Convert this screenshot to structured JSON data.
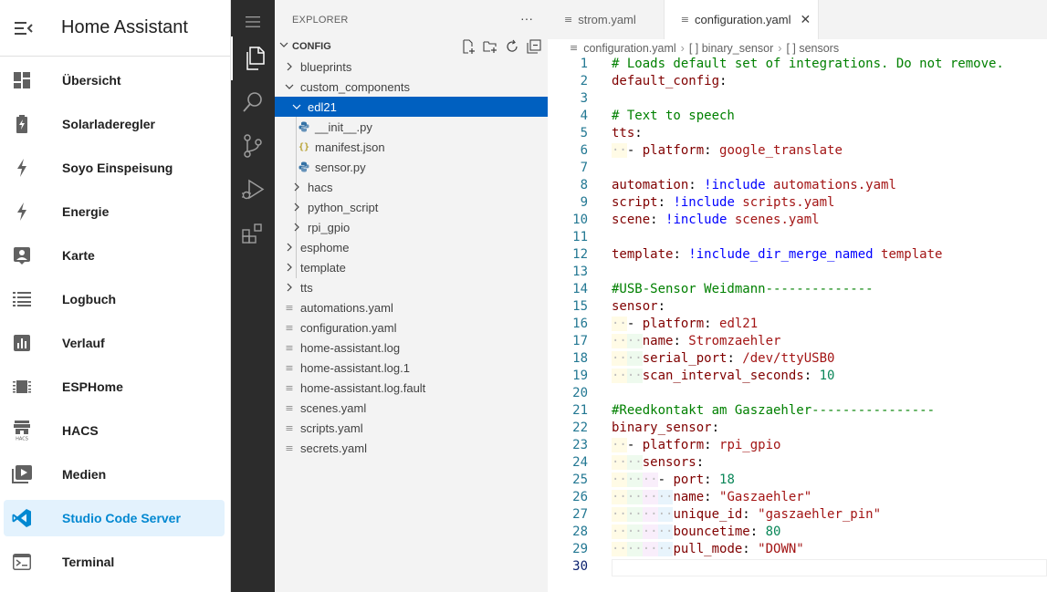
{
  "app": {
    "title": "Home Assistant"
  },
  "ha_nav": [
    {
      "label": "Übersicht",
      "icon": "dashboard-icon"
    },
    {
      "label": "Solarladeregler",
      "icon": "battery-charging-icon"
    },
    {
      "label": "Soyo Einspeisung",
      "icon": "flash-icon"
    },
    {
      "label": "Energie",
      "icon": "flash-icon"
    },
    {
      "label": "Karte",
      "icon": "account-box-icon"
    },
    {
      "label": "Logbuch",
      "icon": "format-list-icon"
    },
    {
      "label": "Verlauf",
      "icon": "chart-box-icon"
    },
    {
      "label": "ESPHome",
      "icon": "chip-icon"
    },
    {
      "label": "HACS",
      "icon": "hacs-store-icon"
    },
    {
      "label": "Medien",
      "icon": "play-box-icon"
    },
    {
      "label": "Studio Code Server",
      "icon": "vscode-icon",
      "active": true
    },
    {
      "label": "Terminal",
      "icon": "console-icon"
    }
  ],
  "explorer": {
    "title": "EXPLORER",
    "more": "···",
    "section": "CONFIG",
    "tree": [
      {
        "label": "blueprints",
        "type": "folder",
        "expanded": false
      },
      {
        "label": "custom_components",
        "type": "folder",
        "expanded": true
      },
      {
        "label": "edl21",
        "type": "folder",
        "expanded": true,
        "selected": true
      },
      {
        "label": "__init__.py",
        "type": "py"
      },
      {
        "label": "manifest.json",
        "type": "json"
      },
      {
        "label": "sensor.py",
        "type": "py"
      },
      {
        "label": "hacs",
        "type": "folder",
        "expanded": false
      },
      {
        "label": "python_script",
        "type": "folder",
        "expanded": false
      },
      {
        "label": "rpi_gpio",
        "type": "folder",
        "expanded": false
      },
      {
        "label": "esphome",
        "type": "folder",
        "expanded": false
      },
      {
        "label": "template",
        "type": "folder",
        "expanded": false
      },
      {
        "label": "tts",
        "type": "folder",
        "expanded": false
      },
      {
        "label": "automations.yaml",
        "type": "file"
      },
      {
        "label": "configuration.yaml",
        "type": "file"
      },
      {
        "label": "home-assistant.log",
        "type": "file"
      },
      {
        "label": "home-assistant.log.1",
        "type": "file"
      },
      {
        "label": "home-assistant.log.fault",
        "type": "file"
      },
      {
        "label": "scenes.yaml",
        "type": "file"
      },
      {
        "label": "scripts.yaml",
        "type": "file"
      },
      {
        "label": "secrets.yaml",
        "type": "file"
      }
    ]
  },
  "tabs": [
    {
      "label": "strom.yaml",
      "active": false
    },
    {
      "label": "configuration.yaml",
      "active": true,
      "close": "✕"
    }
  ],
  "breadcrumb": [
    "configuration.yaml",
    "[ ] binary_sensor",
    "[ ] sensors"
  ],
  "code_lines": [
    {
      "n": "1",
      "parts": [
        [
          "c-com",
          "# Loads default set of integrations. Do not remove."
        ]
      ]
    },
    {
      "n": "2",
      "parts": [
        [
          "c-key",
          "default_config"
        ],
        [
          "",
          ":"
        ]
      ]
    },
    {
      "n": "3",
      "parts": []
    },
    {
      "n": "4",
      "parts": [
        [
          "c-com",
          "# Text to speech"
        ]
      ]
    },
    {
      "n": "5",
      "parts": [
        [
          "c-key",
          "tts"
        ],
        [
          "",
          ":"
        ]
      ]
    },
    {
      "n": "6",
      "parts": [
        [
          "c-ws ind1",
          "··"
        ],
        [
          "",
          "- "
        ],
        [
          "c-key",
          "platform"
        ],
        [
          "",
          ": "
        ],
        [
          "c-str",
          "google_translate"
        ]
      ]
    },
    {
      "n": "7",
      "parts": []
    },
    {
      "n": "8",
      "parts": [
        [
          "c-key",
          "automation"
        ],
        [
          "",
          ": "
        ],
        [
          "c-tag",
          "!include"
        ],
        [
          "c-str",
          " automations.yaml"
        ]
      ]
    },
    {
      "n": "9",
      "parts": [
        [
          "c-key",
          "script"
        ],
        [
          "",
          ": "
        ],
        [
          "c-tag",
          "!include"
        ],
        [
          "c-str",
          " scripts.yaml"
        ]
      ]
    },
    {
      "n": "10",
      "parts": [
        [
          "c-key",
          "scene"
        ],
        [
          "",
          ": "
        ],
        [
          "c-tag",
          "!include"
        ],
        [
          "c-str",
          " scenes.yaml"
        ]
      ]
    },
    {
      "n": "11",
      "parts": []
    },
    {
      "n": "12",
      "parts": [
        [
          "c-key",
          "template"
        ],
        [
          "",
          ": "
        ],
        [
          "c-tag",
          "!include_dir_merge_named"
        ],
        [
          "c-str",
          " template"
        ]
      ]
    },
    {
      "n": "13",
      "parts": []
    },
    {
      "n": "14",
      "parts": [
        [
          "c-com",
          "#USB-Sensor Weidmann--------------"
        ]
      ]
    },
    {
      "n": "15",
      "parts": [
        [
          "c-key",
          "sensor"
        ],
        [
          "",
          ":"
        ]
      ]
    },
    {
      "n": "16",
      "parts": [
        [
          "c-ws ind1",
          "··"
        ],
        [
          "",
          "- "
        ],
        [
          "c-key",
          "platform"
        ],
        [
          "",
          ": "
        ],
        [
          "c-str",
          "edl21"
        ]
      ]
    },
    {
      "n": "17",
      "parts": [
        [
          "c-ws ind1",
          "··"
        ],
        [
          "c-ws ind2",
          "··"
        ],
        [
          "c-key",
          "name"
        ],
        [
          "",
          ": "
        ],
        [
          "c-str",
          "Stromzaehler"
        ]
      ]
    },
    {
      "n": "18",
      "parts": [
        [
          "c-ws ind1",
          "··"
        ],
        [
          "c-ws ind2",
          "··"
        ],
        [
          "c-key",
          "serial_port"
        ],
        [
          "",
          ": "
        ],
        [
          "c-str",
          "/dev/ttyUSB0"
        ]
      ]
    },
    {
      "n": "19",
      "parts": [
        [
          "c-ws ind1",
          "··"
        ],
        [
          "c-ws ind2",
          "··"
        ],
        [
          "c-key",
          "scan_interval_seconds"
        ],
        [
          "",
          ": "
        ],
        [
          "c-num",
          "10"
        ]
      ]
    },
    {
      "n": "20",
      "parts": []
    },
    {
      "n": "21",
      "parts": [
        [
          "c-com",
          "#Reedkontakt am Gaszaehler----------------"
        ]
      ]
    },
    {
      "n": "22",
      "parts": [
        [
          "c-key",
          "binary_sensor"
        ],
        [
          "",
          ":"
        ]
      ]
    },
    {
      "n": "23",
      "parts": [
        [
          "c-ws ind1",
          "··"
        ],
        [
          "",
          "- "
        ],
        [
          "c-key",
          "platform"
        ],
        [
          "",
          ": "
        ],
        [
          "c-str",
          "rpi_gpio"
        ]
      ]
    },
    {
      "n": "24",
      "parts": [
        [
          "c-ws ind1",
          "··"
        ],
        [
          "c-ws ind2",
          "··"
        ],
        [
          "c-key",
          "sensors"
        ],
        [
          "",
          ":"
        ]
      ]
    },
    {
      "n": "25",
      "parts": [
        [
          "c-ws ind1",
          "··"
        ],
        [
          "c-ws ind2",
          "··"
        ],
        [
          "c-ws ind3",
          "··"
        ],
        [
          "",
          "- "
        ],
        [
          "c-key",
          "port"
        ],
        [
          "",
          ": "
        ],
        [
          "c-num",
          "18"
        ]
      ]
    },
    {
      "n": "26",
      "parts": [
        [
          "c-ws ind1",
          "··"
        ],
        [
          "c-ws ind2",
          "··"
        ],
        [
          "c-ws ind3",
          "··"
        ],
        [
          "c-ws ind4",
          "··"
        ],
        [
          "c-key",
          "name"
        ],
        [
          "",
          ": "
        ],
        [
          "c-str",
          "\"Gaszaehler\""
        ]
      ]
    },
    {
      "n": "27",
      "parts": [
        [
          "c-ws ind1",
          "··"
        ],
        [
          "c-ws ind2",
          "··"
        ],
        [
          "c-ws ind3",
          "··"
        ],
        [
          "c-ws ind4",
          "··"
        ],
        [
          "c-key",
          "unique_id"
        ],
        [
          "",
          ": "
        ],
        [
          "c-str",
          "\"gaszaehler_pin\""
        ]
      ]
    },
    {
      "n": "28",
      "parts": [
        [
          "c-ws ind1",
          "··"
        ],
        [
          "c-ws ind2",
          "··"
        ],
        [
          "c-ws ind3",
          "··"
        ],
        [
          "c-ws ind4",
          "··"
        ],
        [
          "c-key",
          "bouncetime"
        ],
        [
          "",
          ": "
        ],
        [
          "c-num",
          "80"
        ]
      ]
    },
    {
      "n": "29",
      "parts": [
        [
          "c-ws ind1",
          "··"
        ],
        [
          "c-ws ind2",
          "··"
        ],
        [
          "c-ws ind3",
          "··"
        ],
        [
          "c-ws ind4",
          "··"
        ],
        [
          "c-key",
          "pull_mode"
        ],
        [
          "",
          ": "
        ],
        [
          "c-str",
          "\"DOWN\""
        ]
      ]
    },
    {
      "n": "30",
      "parts": [],
      "current": true
    }
  ],
  "colors": {
    "ha_accent": "#0288d1",
    "ha_active_bg": "#e3f2fd",
    "activity_bar": "#2c2c2c",
    "explorer_bg": "#f3f3f3",
    "selection": "#0060c0"
  }
}
